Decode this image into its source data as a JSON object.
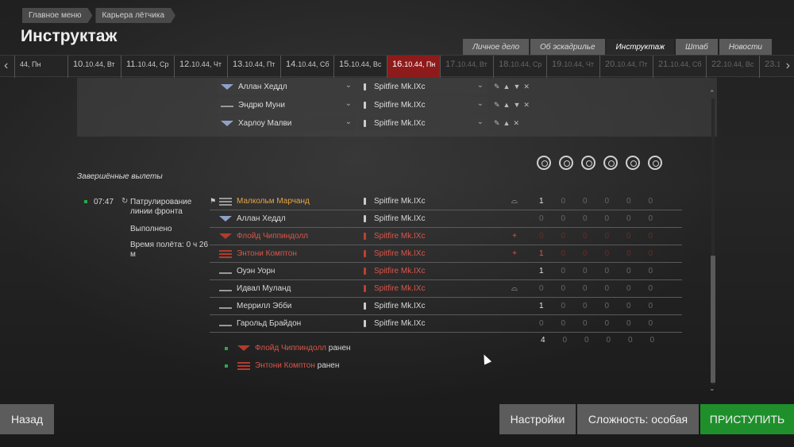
{
  "breadcrumb": [
    "Главное меню",
    "Карьера лётчика"
  ],
  "title": "Инструктаж",
  "tabs": [
    {
      "label": "Личное дело",
      "active": false
    },
    {
      "label": "Об эскадрилье",
      "active": false
    },
    {
      "label": "Инструктаж",
      "active": true
    },
    {
      "label": "Штаб",
      "active": false
    },
    {
      "label": "Новости",
      "active": false
    }
  ],
  "dates": [
    {
      "day": "",
      "rest": "44, Пн",
      "state": "past"
    },
    {
      "day": "10.",
      "rest": "10.44, Вт",
      "state": "past"
    },
    {
      "day": "11.",
      "rest": "10.44, Ср",
      "state": "past"
    },
    {
      "day": "12.",
      "rest": "10.44, Чт",
      "state": "past"
    },
    {
      "day": "13.",
      "rest": "10.44, Пт",
      "state": "past"
    },
    {
      "day": "14.",
      "rest": "10.44, Сб",
      "state": "past"
    },
    {
      "day": "15.",
      "rest": "10.44, Вс",
      "state": "past"
    },
    {
      "day": "16.",
      "rest": "10.44, Пн",
      "state": "selected"
    },
    {
      "day": "17.",
      "rest": "10.44, Вт",
      "state": "future"
    },
    {
      "day": "18.",
      "rest": "10.44, Ср",
      "state": "future"
    },
    {
      "day": "19.",
      "rest": "10.44, Чт",
      "state": "future"
    },
    {
      "day": "20.",
      "rest": "10.44, Пт",
      "state": "future"
    },
    {
      "day": "21.",
      "rest": "10.44, Сб",
      "state": "future"
    },
    {
      "day": "22.",
      "rest": "10.44, Вс",
      "state": "future"
    },
    {
      "day": "23.",
      "rest": "10.44, Пн",
      "state": "future"
    }
  ],
  "planned": [
    {
      "pilot": "Аллан Хеддл",
      "plane": "Spitfire Mk.IXc"
    },
    {
      "pilot": "Эндрю Муни",
      "plane": "Spitfire Mk.IXc"
    },
    {
      "pilot": "Харлоу Малви",
      "plane": "Spitfire Mk.IXc"
    }
  ],
  "completed_title": "Завершённые вылеты",
  "mission": {
    "time": "07:47",
    "name": "Патрулирование линии фронта",
    "status": "Выполнено",
    "flight_time": "Время полёта: 0 ч 26 м"
  },
  "pilots": [
    {
      "name": "Малкольм Марчанд",
      "plane": "Spitfire Mk.IXc",
      "color": "orange",
      "status": "cap",
      "stats": [
        "1",
        "0",
        "0",
        "0",
        "0",
        "0"
      ]
    },
    {
      "name": "Аллан Хеддл",
      "plane": "Spitfire Mk.IXc",
      "color": "normal",
      "status": "",
      "stats": [
        "0",
        "0",
        "0",
        "0",
        "0",
        "0"
      ]
    },
    {
      "name": "Флойд Чиппиндолл",
      "plane": "Spitfire Mk.IXc",
      "color": "red",
      "status": "+",
      "stats": [
        "0",
        "0",
        "0",
        "0",
        "0",
        "0"
      ]
    },
    {
      "name": "Энтони Комптон",
      "plane": "Spitfire Mk.IXc",
      "color": "red",
      "status": "+",
      "stats": [
        "1",
        "0",
        "0",
        "0",
        "0",
        "0"
      ]
    },
    {
      "name": "Оуэн Уорн",
      "plane": "Spitfire Mk.IXc",
      "color": "plane-red",
      "status": "",
      "stats": [
        "1",
        "0",
        "0",
        "0",
        "0",
        "0"
      ]
    },
    {
      "name": "Идвал Муланд",
      "plane": "Spitfire Mk.IXc",
      "color": "plane-red",
      "status": "cap",
      "stats": [
        "0",
        "0",
        "0",
        "0",
        "0",
        "0"
      ]
    },
    {
      "name": "Меррилл Эбби",
      "plane": "Spitfire Mk.IXc",
      "color": "normal",
      "status": "",
      "stats": [
        "1",
        "0",
        "0",
        "0",
        "0",
        "0"
      ]
    },
    {
      "name": "Гарольд Брайдон",
      "plane": "Spitfire Mk.IXc",
      "color": "normal",
      "status": "",
      "stats": [
        "0",
        "0",
        "0",
        "0",
        "0",
        "0"
      ]
    }
  ],
  "totals": [
    "4",
    "0",
    "0",
    "0",
    "0",
    "0"
  ],
  "wounded": [
    {
      "name": "Флойд Чиппиндолл",
      "label": "ранен"
    },
    {
      "name": "Энтони Комптон",
      "label": "ранен"
    }
  ],
  "buttons": {
    "back": "Назад",
    "settings": "Настройки",
    "difficulty": "Сложность: особая",
    "start": "ПРИСТУПИТЬ"
  }
}
